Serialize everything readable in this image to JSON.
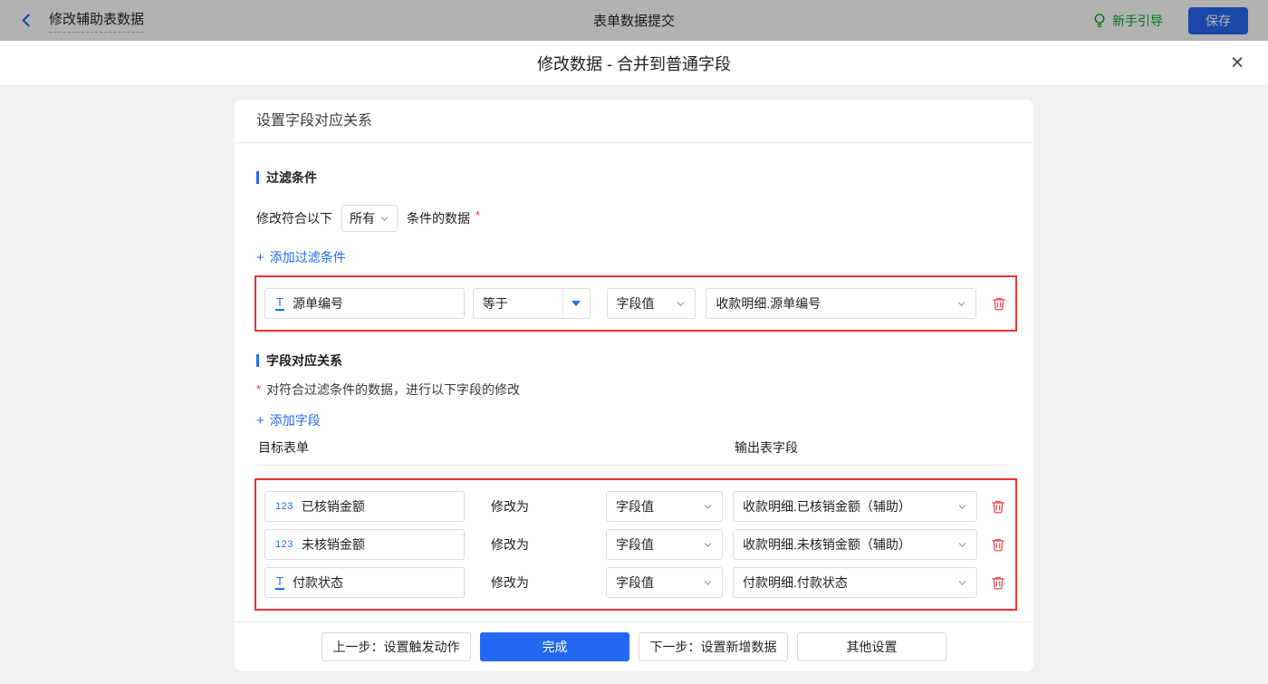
{
  "colors": {
    "accent_blue": "#2468f2",
    "highlight_red": "#f23030",
    "guide_green": "#00a82d"
  },
  "icons": {
    "add": "+",
    "close": "✕"
  },
  "topbar": {
    "back_label": "修改辅助表数据",
    "center_title": "表单数据提交",
    "guide_label": "新手引导",
    "save_label": "保存"
  },
  "dialog": {
    "title": "修改数据 - 合并到普通字段"
  },
  "card": {
    "heading": "设置字段对应关系",
    "filter_section": {
      "title": "过滤条件",
      "match_prefix": "修改符合以下",
      "match_value": "所有",
      "match_suffix": "条件的数据",
      "required_mark": "*",
      "add_link": "添加过滤条件",
      "condition": {
        "field_icon": "T",
        "field": "源单编号",
        "operator": "等于",
        "value_type": "字段值",
        "value": "收款明细.源单编号"
      }
    },
    "mapping_section": {
      "title": "字段对应关系",
      "required_mark": "*",
      "description": "对符合过滤条件的数据，进行以下字段的修改",
      "add_link": "添加字段",
      "col_target": "目标表单",
      "col_output": "输出表字段",
      "modify_label": "修改为",
      "rows": [
        {
          "field_icon": "123",
          "field": "已核销金额",
          "value_type": "字段值",
          "value": "收款明细.已核销金额（辅助）"
        },
        {
          "field_icon": "123",
          "field": "未核销金额",
          "value_type": "字段值",
          "value": "收款明细.未核销金额（辅助）"
        },
        {
          "field_icon": "T",
          "field": "付款状态",
          "value_type": "字段值",
          "value": "付款明细.付款状态"
        }
      ]
    },
    "footer": {
      "prev_label": "上一步：设置触发动作",
      "done_label": "完成",
      "next_label": "下一步：设置新增数据",
      "other_label": "其他设置"
    }
  }
}
